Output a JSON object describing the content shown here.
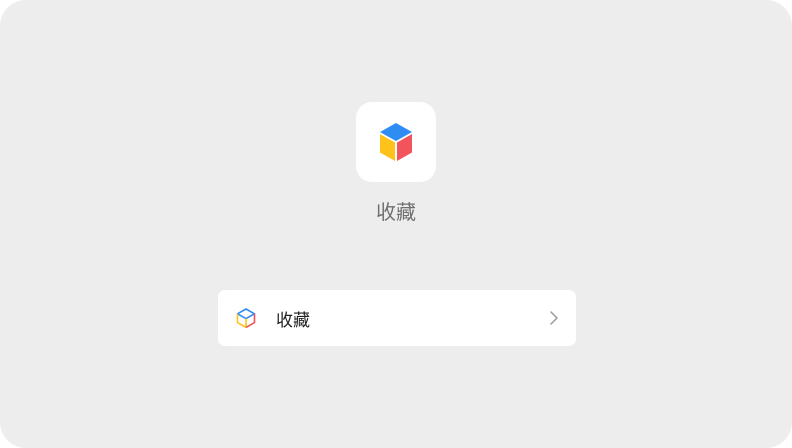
{
  "app": {
    "title": "收藏",
    "icon": "cube-icon"
  },
  "list": {
    "items": [
      {
        "label": "收藏",
        "icon": "cube-outline-icon",
        "trailing_icon": "chevron-right-icon"
      }
    ]
  },
  "colors": {
    "background": "#ededed",
    "card": "#ffffff",
    "cube_top": "#2f8cf2",
    "cube_left": "#ffc21a",
    "cube_right": "#f2545b"
  }
}
